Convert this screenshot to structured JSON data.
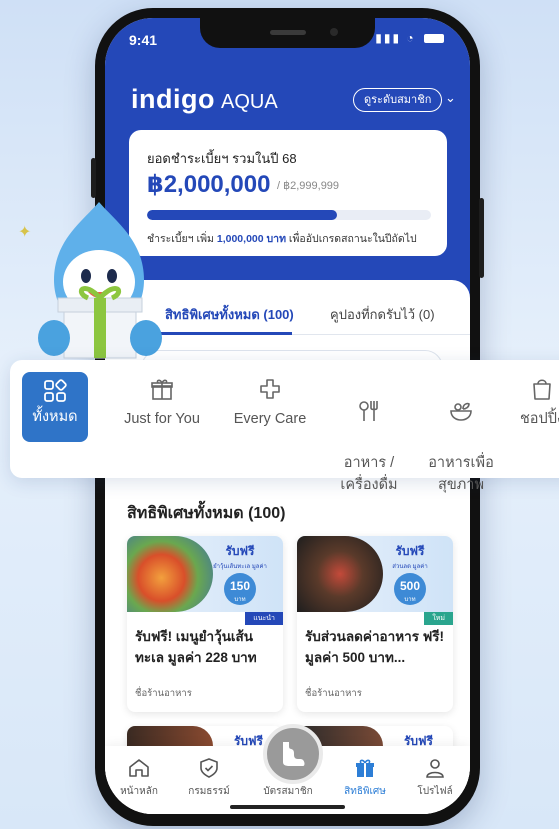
{
  "status_bar": {
    "time": "9:41"
  },
  "header": {
    "brand_main": "indigo",
    "brand_sub": "AQUA",
    "tier_button": "ดูระดับสมาชิก"
  },
  "spend_card": {
    "title": "ยอดชำระเบี้ยฯ รวมในปี 68",
    "amount": "฿2,000,000",
    "target": "/ ฿2,999,999",
    "progress_fraction": 0.67,
    "note_prefix": "ชำระเบี้ยฯ เพิ่ม ",
    "note_amount": "1,000,000 บาท",
    "note_suffix": " เพื่ออัปเกรดสถานะในปีถัดไป"
  },
  "tabs": {
    "all": "สิทธิพิเศษทั้งหมด (100)",
    "coupons": "คูปองที่กดรับไว้ (0)"
  },
  "categories": [
    {
      "label": "ทั้งหมด",
      "icon": "grid-icon",
      "active": true
    },
    {
      "label": "Just for You",
      "icon": "gift-icon"
    },
    {
      "label": "Every Care",
      "icon": "care-icon"
    },
    {
      "label": "อาหาร /\nเครื่องดื่ม",
      "icon": "utensils-icon"
    },
    {
      "label": "อาหารเพื่อ\nสุขภาพ",
      "icon": "salad-bowl-icon"
    },
    {
      "label": "ชอปปิ้ง",
      "icon": "shopping-bag-icon"
    }
  ],
  "section_title": "สิทธิพิเศษทั้งหมด (100)",
  "deals": [
    {
      "promo_free": "รับฟรี",
      "promo_sub": "ยำวุ้นเส้นทะเล มูลค่า",
      "promo_value": "150",
      "promo_unit": "บาท",
      "ribbon": "แนะนำ",
      "title": "รับฟรี! เมนูยำวุ้นเส้นทะเล มูลค่า 228 บาท",
      "shop": "ชื่อร้านอาหาร"
    },
    {
      "promo_free": "รับฟรี",
      "promo_sub": "ส่วนลด มูลค่า",
      "promo_value": "500",
      "promo_unit": "บาท",
      "ribbon": "ใหม่",
      "title": "รับส่วนลดค่าอาหาร ฟรี! มูลค่า 500 บาท...",
      "shop": "ชื่อร้านอาหาร"
    },
    {
      "promo_free": "รับฟรี"
    },
    {
      "promo_free": "รับฟรี"
    }
  ],
  "bottom_nav": [
    {
      "label": "หน้าหลัก",
      "icon": "home-icon"
    },
    {
      "label": "กรมธรรม์",
      "icon": "shield-icon"
    },
    {
      "label": "บัตรสมาชิก",
      "icon": "member-card-icon"
    },
    {
      "label": "สิทธิพิเศษ",
      "icon": "gift-icon",
      "active": true
    },
    {
      "label": "โปรไฟล์",
      "icon": "profile-icon"
    }
  ],
  "colors": {
    "brand_blue": "#2448b8",
    "accent_blue": "#2f74c8",
    "nav_active": "#2d7ed6",
    "ribbon_new": "#2aa58e"
  }
}
